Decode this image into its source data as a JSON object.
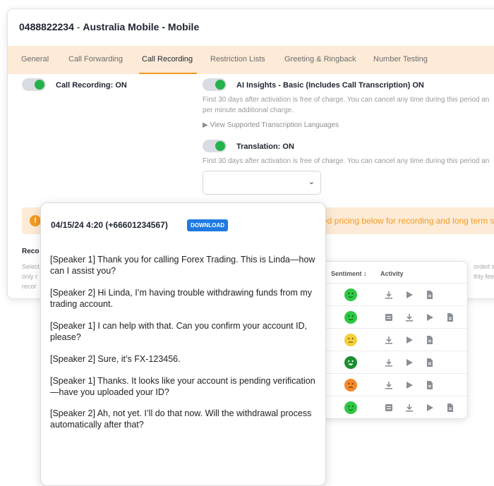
{
  "header": {
    "number": "0488822234",
    "separator": " - ",
    "carrier": "Australia Mobile - Mobile"
  },
  "tabs": [
    {
      "label": "General",
      "active": false
    },
    {
      "label": "Call Forwarding",
      "active": false
    },
    {
      "label": "Call Recording",
      "active": true
    },
    {
      "label": "Restriction Lists",
      "active": false
    },
    {
      "label": "Greeting & Ringback",
      "active": false
    },
    {
      "label": "Number Testing",
      "active": false
    }
  ],
  "settings": {
    "call_recording_label": "Call Recording: ON",
    "call_recording_on": true,
    "ai_insights_label": "AI Insights - Basic (Includes Call Transcription) ON",
    "ai_insights_on": true,
    "ai_note_line1": "First 30 days after activation is free of charge. You can cancel any time during this period an",
    "ai_note_line2": "per minute additional charge.",
    "languages_link": "▶ View Supported Transcription Languages",
    "translation_label": "Translation: ON",
    "translation_on": true,
    "translation_note": "First 30 days after activation is free of charge. You can cancel any time during this period an"
  },
  "alert": {
    "icon": "!",
    "text": "ed pricing below for recording and long term st"
  },
  "recordings": {
    "heading": "Reco",
    "sub_lines": [
      "Select",
      "only r",
      "recor"
    ],
    "right_lines": [
      "orded so",
      "thly fee c"
    ]
  },
  "table": {
    "col_sentiment": "Sentiment",
    "sort_icon": "↕",
    "col_activity": "Activity",
    "rows": [
      {
        "sentiment": "positive",
        "color": "#2ec844",
        "actions": [
          "download-icon",
          "play-icon",
          "document-icon"
        ]
      },
      {
        "sentiment": "positive",
        "color": "#2ec844",
        "actions": [
          "voicemail-icon",
          "download-icon",
          "play-icon",
          "document-icon"
        ]
      },
      {
        "sentiment": "neutral",
        "color": "#f5cf3a",
        "actions": [
          "download-icon",
          "play-icon",
          "document-icon"
        ]
      },
      {
        "sentiment": "very-positive",
        "color": "#1a8f2e",
        "actions": [
          "download-icon",
          "play-icon",
          "document-icon"
        ]
      },
      {
        "sentiment": "negative",
        "color": "#f5892a",
        "actions": [
          "download-icon",
          "play-icon",
          "document-icon"
        ]
      },
      {
        "sentiment": "positive",
        "color": "#2ec844",
        "actions": [
          "voicemail-icon",
          "download-icon",
          "play-icon",
          "document-icon"
        ]
      }
    ]
  },
  "transcript": {
    "title": "04/15/24 4:20 (+66601234567)",
    "download_label": "DOWNLOAD",
    "lines": [
      "[Speaker 1] Thank you for calling Forex Trading. This is Linda—how can I assist you?",
      "[Speaker 2] Hi Linda, I’m having trouble withdrawing funds from my trading account.",
      "[Speaker 1] I can help with that. Can you confirm your account ID, please?",
      "[Speaker 2] Sure, it’s FX-123456.",
      "[Speaker 1] Thanks. It looks like your account is pending verification—have you uploaded your ID?",
      "[Speaker 2] Ah, not yet. I’ll do that now. Will the withdrawal process automatically after that?"
    ]
  },
  "colors": {
    "accent": "#f39a1e",
    "tab_bar": "#fdebd7",
    "toggle_on": "#24b24b",
    "download_button": "#1f7ae0"
  }
}
